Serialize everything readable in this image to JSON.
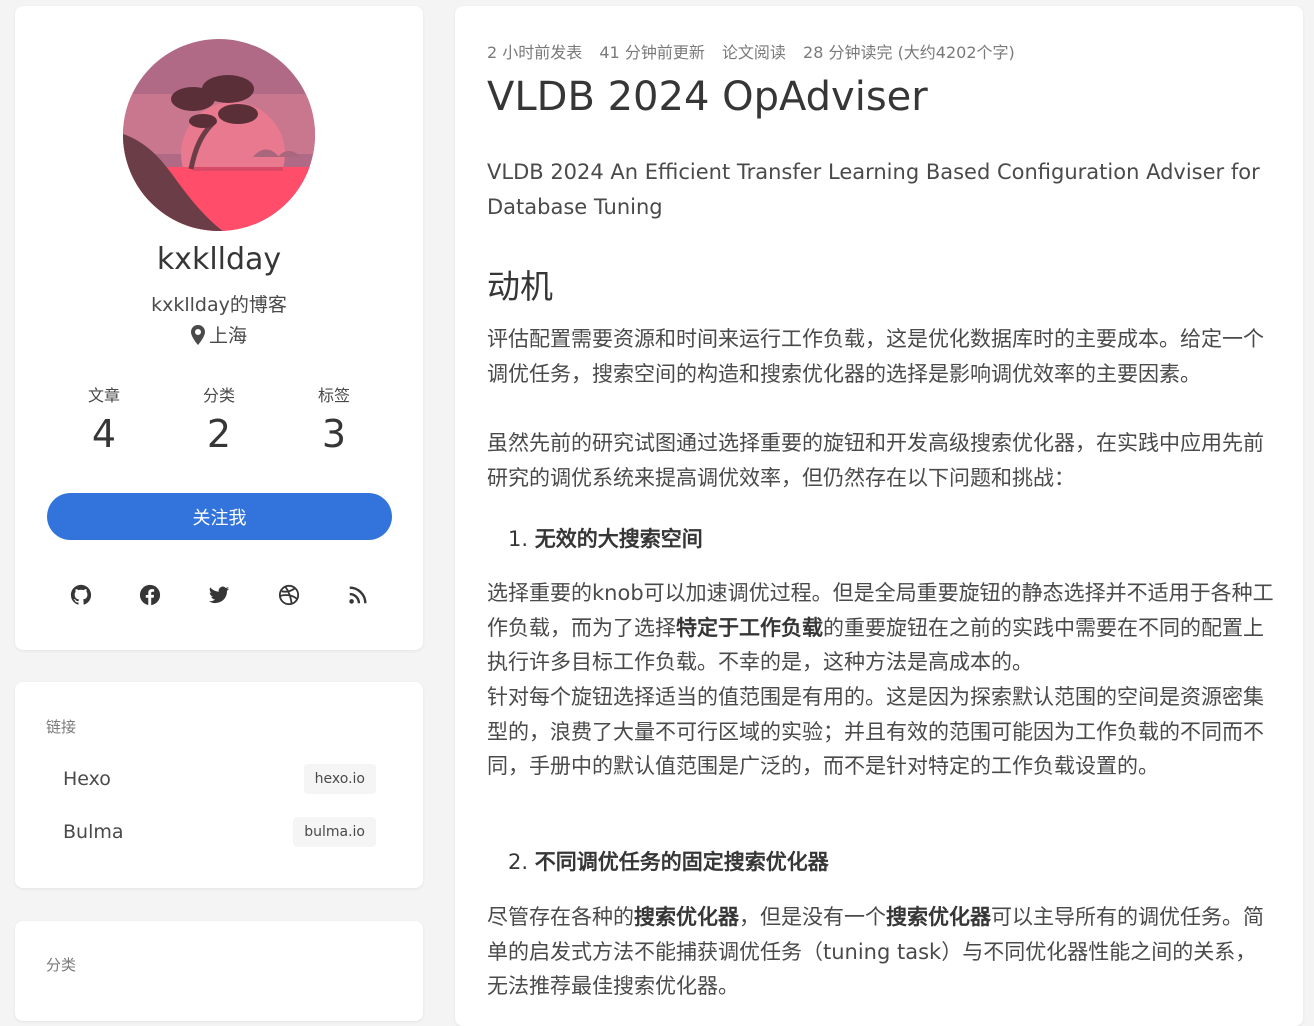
{
  "profile": {
    "name": "kxkllday",
    "description": "kxkllday的博客",
    "location": "上海",
    "stats": [
      {
        "label": "文章",
        "value": "4"
      },
      {
        "label": "分类",
        "value": "2"
      },
      {
        "label": "标签",
        "value": "3"
      }
    ],
    "follow_label": "关注我",
    "social": [
      "github-icon",
      "facebook-icon",
      "twitter-icon",
      "dribbble-icon",
      "rss-icon"
    ]
  },
  "links": {
    "title": "链接",
    "items": [
      {
        "name": "Hexo",
        "domain": "hexo.io"
      },
      {
        "name": "Bulma",
        "domain": "bulma.io"
      }
    ]
  },
  "categories": {
    "title": "分类"
  },
  "article": {
    "meta": [
      "2 小时前发表",
      "41 分钟前更新",
      "论文阅读",
      "28 分钟读完 (大约4202个字)"
    ],
    "title": "VLDB 2024 OpAdviser",
    "subtitle_line1": "VLDB 2024 An Efficient Transfer Learning Based Configuration Adviser for",
    "subtitle_line2": "Database Tuning",
    "section_heading": "动机",
    "p1": "评估配置需要资源和时间来运行工作负载，这是优化数据库时的主要成本。给定一个调优任务，搜索空间的构造和搜索优化器的选择是影响调优效率的主要因素。",
    "p2": "虽然先前的研究试图通过选择重要的旋钮和开发高级搜索优化器，在实践中应用先前研究的调优系统来提高调优效率，但仍然存在以下问题和挑战：",
    "item1_num": "1.",
    "item1": "无效的大搜索空间",
    "p3_a": "选择重要的knob可以加速调优过程。但是全局重要旋钮的静态选择并不适用于各种工作负载，而为了选择",
    "p3_bold": "特定于工作负载",
    "p3_b": "的重要旋钮在之前的实践中需要在不同的配置上执行许多目标工作负载。不幸的是，这种方法是高成本的。",
    "p4": "针对每个旋钮选择适当的值范围是有用的。这是因为探索默认范围的空间是资源密集型的，浪费了大量不可行区域的实验；并且有效的范围可能因为工作负载的不同而不同，手册中的默认值范围是广泛的，而不是针对特定的工作负载设置的。",
    "item2_num": "2.",
    "item2": "不同调优任务的固定搜索优化器",
    "p5_a": "尽管存在各种的",
    "p5_bold1": "搜索优化器",
    "p5_b": "，但是没有一个",
    "p5_bold2": "搜索优化器",
    "p5_c": "可以主导所有的调优任务。简单的启发式方法不能捕获调优任务（tuning task）与不同优化器性能之间的关系，无法推荐最佳搜索优化器。"
  },
  "colors": {
    "accent": "#3273dc",
    "background": "#f4f4f5"
  }
}
